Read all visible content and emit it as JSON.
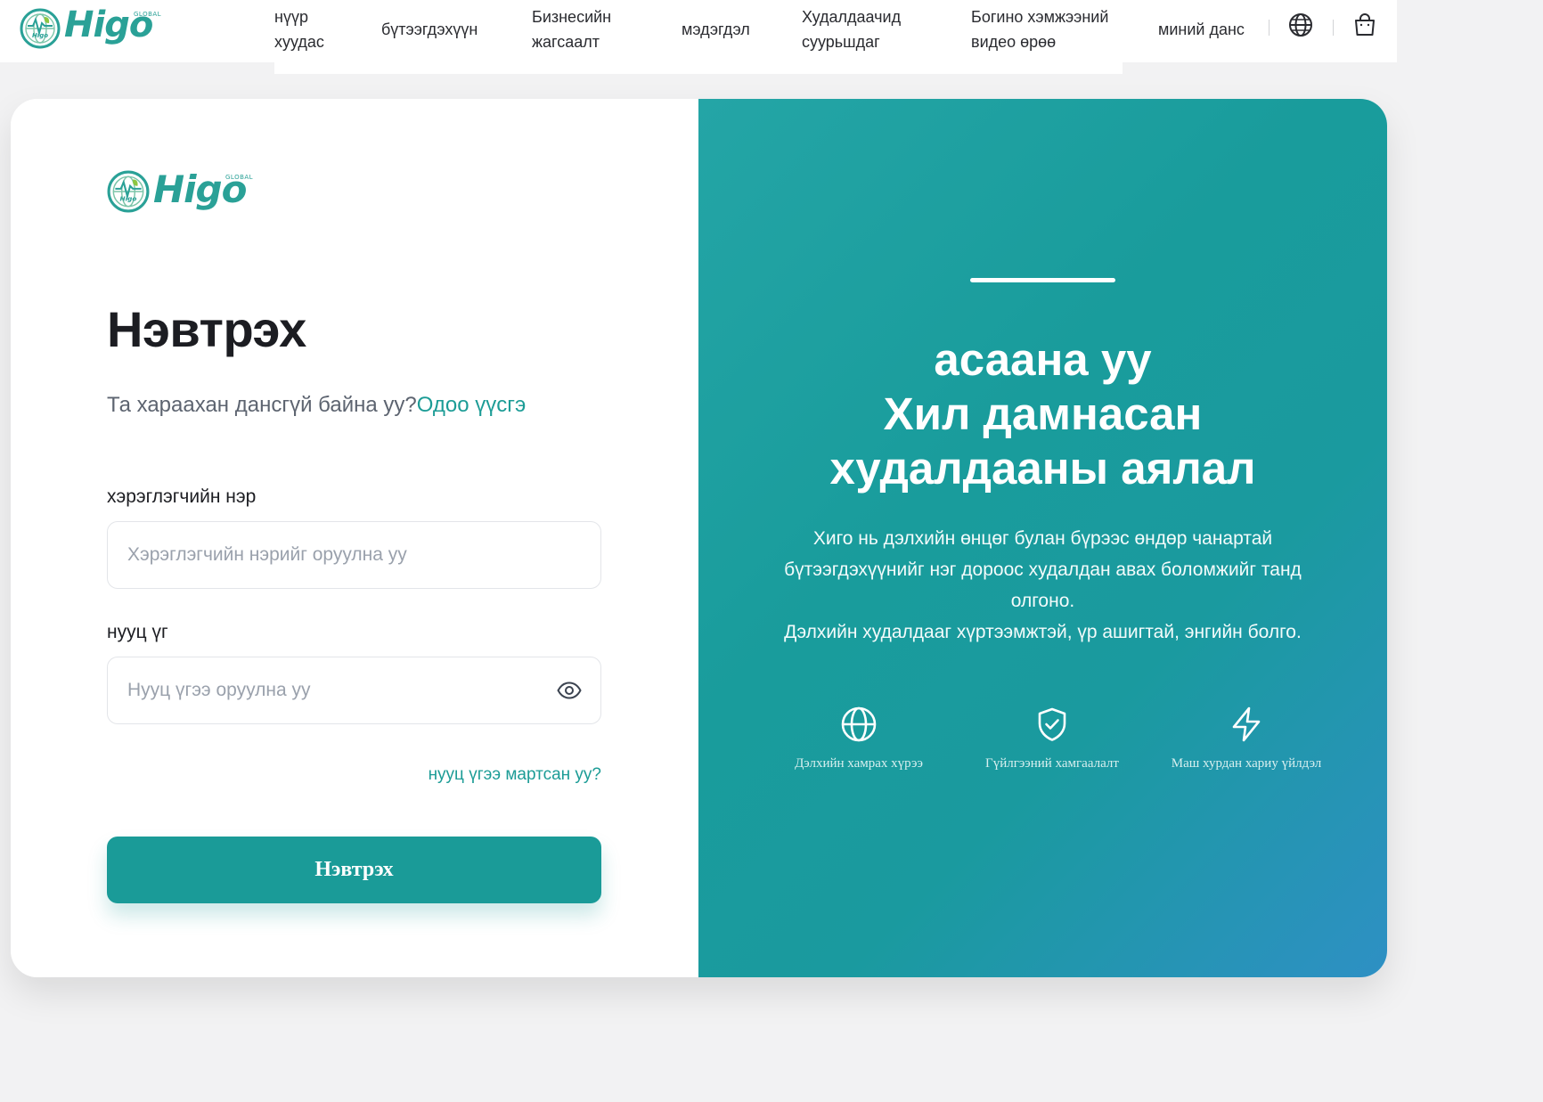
{
  "brand": {
    "wordmark": "Higo",
    "tagline": "GLOBAL",
    "mark_text": "Higo",
    "color": "#2aa197"
  },
  "nav": {
    "links": [
      {
        "label": "нүүр хуудас"
      },
      {
        "label": "бүтээгдэхүүн"
      },
      {
        "label": "Бизнесийн жагсаалт"
      },
      {
        "label": "мэдэгдэл"
      },
      {
        "label": "Худалдаачид суурьшдаг"
      },
      {
        "label": "Богино хэмжээний видео өрөө"
      },
      {
        "label": "миний данс"
      }
    ],
    "icons": [
      "globe-icon",
      "shopping-bag-icon"
    ]
  },
  "login": {
    "title": "Нэвтрэх",
    "no_account": "Та хараахан дансгүй байна уу?",
    "signup_link": "Одоо үүсгэ",
    "username_label": "хэрэглэгчийн нэр",
    "username_placeholder": "Хэрэглэгчийн нэрийг оруулна уу",
    "password_label": "нууц үг",
    "password_placeholder": "Нууц үгээ оруулна уу",
    "forgot_link": "нууц үгээ мартсан уу?",
    "submit_label": "Нэвтрэх"
  },
  "promo": {
    "heading_lines": [
      "асаана уу",
      "Хил дамнасан",
      "худалдааны аялал"
    ],
    "description_lines": [
      "Хиго нь дэлхийн өнцөг булан бүрээс өндөр чанартай",
      "бүтээгдэхүүнийг нэг дороос худалдан авах боломжийг танд",
      "олгоно.",
      "Дэлхийн худалдааг хүртээмжтэй, үр ашигтай, энгийн болго."
    ],
    "features": [
      {
        "icon": "globe-icon",
        "label": "Дэлхийн хамрах хүрээ"
      },
      {
        "icon": "shield-check-icon",
        "label": "Гүйлгээний хамгаалалт"
      },
      {
        "icon": "lightning-icon",
        "label": "Маш хурдан хариу үйлдэл"
      }
    ]
  },
  "colors": {
    "accent": "#1a9b98",
    "promo_gradient_start": "#24a5a6",
    "promo_gradient_end": "#2e90c4",
    "page_background": "#f2f2f3"
  }
}
